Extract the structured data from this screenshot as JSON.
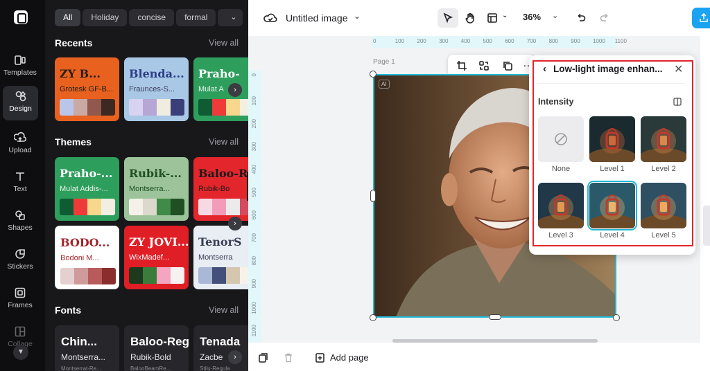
{
  "rail": {
    "items": [
      {
        "label": "Templates",
        "icon": "templates-icon"
      },
      {
        "label": "Design",
        "icon": "design-icon"
      },
      {
        "label": "Upload",
        "icon": "upload-icon"
      },
      {
        "label": "Text",
        "icon": "text-icon"
      },
      {
        "label": "Shapes",
        "icon": "shapes-icon"
      },
      {
        "label": "Stickers",
        "icon": "stickers-icon"
      },
      {
        "label": "Frames",
        "icon": "frames-icon"
      },
      {
        "label": "Collage",
        "icon": "collage-icon"
      }
    ],
    "active": "Design"
  },
  "panel": {
    "chips": [
      "All",
      "Holiday",
      "concise",
      "formal",
      "c"
    ],
    "recents": {
      "title": "Recents",
      "view_all": "View all",
      "cards": [
        {
          "t1": "ZY B...",
          "t2": "Grotesk GF-B...",
          "bg": "#e8611e",
          "c1": "#2b1d14",
          "c2": "#1d1d1d",
          "swatches": [
            "#b9c6ea",
            "#c8a9a4",
            "#91594d",
            "#3c2a22"
          ]
        },
        {
          "t1": "Blenda...",
          "t2": "Fraunces-S...",
          "bg": "#a9c8e6",
          "c1": "#2c3e88",
          "c2": "#3d3d5a",
          "swatches": [
            "#d8d3f0",
            "#b6a6d6",
            "#f0ecdf",
            "#3a3f7a"
          ]
        },
        {
          "t1": "Praho-",
          "t2": "Mulat A",
          "bg": "#2e9e5c",
          "c1": "#ffffff",
          "c2": "#e9f3ec",
          "swatches": [
            "#0f5c34",
            "#ef3a3a",
            "#f6d78c",
            "#f2efe2"
          ]
        }
      ]
    },
    "themes": {
      "title": "Themes",
      "view_all": "View all",
      "cards": [
        {
          "t1": "Praho-...",
          "t2": "Mulat Addis-...",
          "bg": "#2e9e5c",
          "c1": "#ffffff",
          "c2": "#e9f3ec",
          "swatches": [
            "#0f5c34",
            "#ef3a3a",
            "#f6d78c",
            "#f2efe2"
          ]
        },
        {
          "t1": "Rubik-...",
          "t2": "Montserra...",
          "bg": "#9cc39a",
          "c1": "#1f4f22",
          "c2": "#1f4f22",
          "swatches": [
            "#f4f1ea",
            "#dcd9cc",
            "#3f8b47",
            "#1f4f22"
          ]
        },
        {
          "t1": "Baloo-Regu",
          "t2": "Rubik-Bo",
          "bg": "#e3262b",
          "c1": "#1b1b1b",
          "c2": "#1b1b1b",
          "swatches": [
            "#f7d9e4",
            "#f39cb9",
            "#eceaea",
            "#d44a5e"
          ]
        },
        {
          "t1": "BODO...",
          "t2": "Bodoni M...",
          "bg": "#ffffff",
          "c1": "#a3242c",
          "c2": "#a3242c",
          "swatches": [
            "#e6cfcf",
            "#cf9a9a",
            "#b85b5b",
            "#8a2d2d"
          ]
        },
        {
          "t1": "ZY JOVI...",
          "t2": "WixMadef...",
          "bg": "#e01e26",
          "c1": "#ffffff",
          "c2": "#ffffff",
          "swatches": [
            "#1e3a1e",
            "#3a7d3a",
            "#f4a6c0",
            "#f7f1f1"
          ]
        },
        {
          "t1": "TenorS",
          "t2": "Montserra",
          "bg": "#e9edf4",
          "c1": "#3a3f55",
          "c2": "#3a3f55",
          "swatches": [
            "#aab8d8",
            "#44507a",
            "#d5c6b0",
            "#f6f2ea"
          ]
        }
      ]
    },
    "fonts": {
      "title": "Fonts",
      "view_all": "View all",
      "cards": [
        {
          "f1": "Chin...",
          "f2": "Montserra...",
          "f3": "Montserrat-Re..."
        },
        {
          "f1": "Baloo-Regul...",
          "f2": "Rubik-Bold",
          "f3": "BalooBeamRe..."
        },
        {
          "f1": "Tenada",
          "f2": "Zacbe",
          "f3": "Stilu-Regula"
        }
      ]
    }
  },
  "topbar": {
    "title": "Untitled image",
    "zoom": "36%"
  },
  "canvas": {
    "page_label": "Page 1",
    "ai_badge": "AI",
    "ruler_h": [
      "0",
      "100",
      "200",
      "300",
      "400",
      "500",
      "600",
      "700",
      "800",
      "900",
      "1000",
      "1100"
    ],
    "ruler_v": [
      "0",
      "100",
      "200",
      "300",
      "400",
      "500",
      "600",
      "700",
      "800",
      "900",
      "1000",
      "1100"
    ]
  },
  "popover": {
    "title": "Low-light image enhan...",
    "intensity_label": "Intensity",
    "levels": [
      "None",
      "Level 1",
      "Level 2",
      "Level 3",
      "Level 4",
      "Level 5"
    ],
    "selected": "Level 4"
  },
  "bottombar": {
    "add_page": "Add page"
  },
  "colors": {
    "accent": "#21b9d6",
    "export": "#1aa3f0",
    "highlight": "#e1252e"
  }
}
